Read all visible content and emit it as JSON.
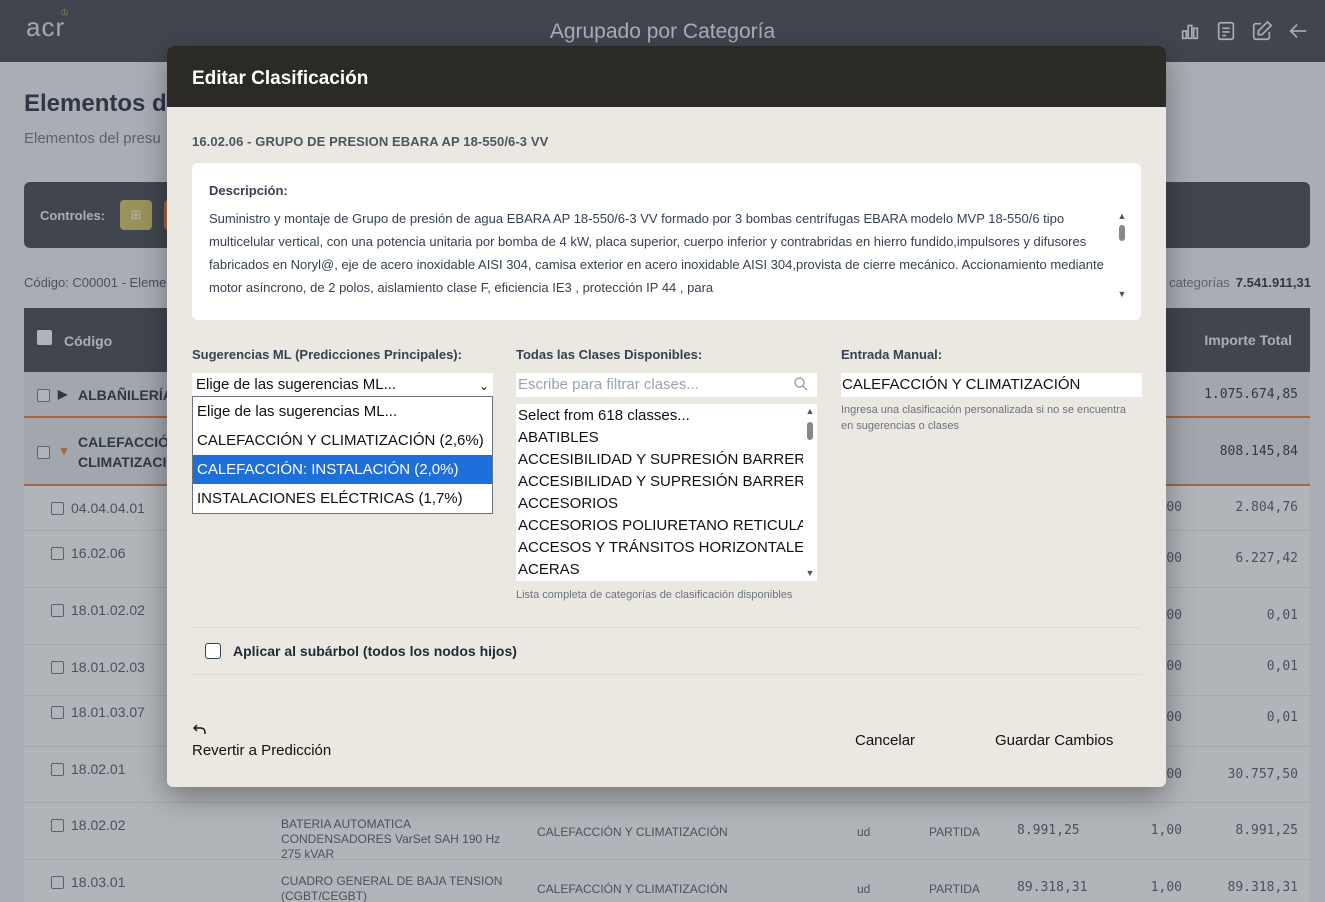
{
  "app": {
    "logo": "acr",
    "title": "Agrupado por Categoría"
  },
  "page": {
    "title": "Elementos de",
    "subtitle": "Elementos del presu",
    "controls_label": "Controles:",
    "code_line": "Código: C00001 - Eleme",
    "total_label": "categorías",
    "total_value": "7.541.911,31"
  },
  "table": {
    "header_code": "Código",
    "header_total": "Importe Total",
    "groups": [
      {
        "name": "ALBAÑILERÍA",
        "total": "1.075.674,85"
      },
      {
        "name_line1": "CALEFACCIÓN",
        "name_line2": "CLIMATIZACIÓ",
        "total": "808.145,84"
      }
    ],
    "rows": [
      {
        "code": "04.04.04.01",
        "qty": "00",
        "total": "2.804,76"
      },
      {
        "code": "16.02.06",
        "qty": "00",
        "total": "6.227,42"
      },
      {
        "code": "18.01.02.02",
        "qty": "00",
        "total": "0,01"
      },
      {
        "code": "18.01.02.03",
        "qty": "00",
        "total": "0,01"
      },
      {
        "code": "18.01.03.07",
        "qty": "00",
        "total": "0,01"
      },
      {
        "code": "18.02.01",
        "qty": "00",
        "total": "30.757,50"
      },
      {
        "code": "18.02.02",
        "desc": "BATERIA AUTOMATICA CONDENSADORES VarSet SAH 190 Hz 275 kVAR",
        "cls": "CALEFACCIÓN Y CLIMATIZACIÓN",
        "unit": "ud",
        "type": "PARTIDA",
        "price": "8.991,25",
        "qty": "1,00",
        "total": "8.991,25"
      },
      {
        "code": "18.03.01",
        "desc": "CUADRO GENERAL DE BAJA TENSION (CGBT/CEGBT)",
        "cls": "CALEFACCIÓN Y CLIMATIZACIÓN",
        "unit": "ud",
        "type": "PARTIDA",
        "price": "89.318,31",
        "qty": "1,00",
        "total": "89.318,31"
      }
    ]
  },
  "modal": {
    "title": "Editar Clasificación",
    "item_title": "16.02.06 - GRUPO DE PRESION EBARA AP 18-550/6-3 VV",
    "desc_label": "Descripción:",
    "desc_text": "Suministro y montaje de Grupo de presión de agua EBARA AP 18-550/6-3 VV formado por 3 bombas centrífugas EBARA modelo MVP 18-550/6 tipo multicelular vertical, con una potencia unitaria por bomba de 4 kW, placa superior, cuerpo inferior y contrabridas en hierro fundido,impulsores y difusores fabricados en Noryl@, eje de acero inoxidable AISI 304, camisa exterior en acero inoxidable AISI 304,provista de cierre mecánico. Accionamiento mediante motor asíncrono, de 2 polos, aislamiento clase F, eficiencia IE3 , protección IP 44 , para",
    "ml": {
      "label": "Sugerencias ML (Predicciones Principales):",
      "selected": "Elige de las sugerencias ML...",
      "options": [
        "Elige de las sugerencias ML...",
        "CALEFACCIÓN Y CLIMATIZACIÓN (2,6%)",
        "CALEFACCIÓN: INSTALACIÓN (2,0%)",
        "INSTALACIONES ELÉCTRICAS (1,7%)"
      ],
      "highlighted_index": 2
    },
    "classes": {
      "label": "Todas las Clases Disponibles:",
      "placeholder": "Escribe para filtrar clases...",
      "options": [
        "Select from 618 classes...",
        "ABATIBLES",
        "ACCESIBILIDAD Y SUPRESIÓN BARRERAS",
        "ACCESIBILIDAD Y SUPRESIÓN BARRERAS",
        "ACCESORIOS",
        "ACCESORIOS POLIURETANO RETICULADO",
        "ACCESOS Y TRÁNSITOS HORIZONTALES",
        "ACERAS"
      ],
      "hint": "Lista completa de categorías de clasificación disponibles"
    },
    "manual": {
      "label": "Entrada Manual:",
      "value": "CALEFACCIÓN Y CLIMATIZACIÓN",
      "hint": "Ingresa una clasificación personalizada si no se encuentra en sugerencias o clases"
    },
    "subtree_label": "Aplicar al subárbol (todos los nodos hijos)",
    "revert_label": "Revertir a Predicción",
    "cancel_label": "Cancelar",
    "save_label": "Guardar Cambios"
  }
}
